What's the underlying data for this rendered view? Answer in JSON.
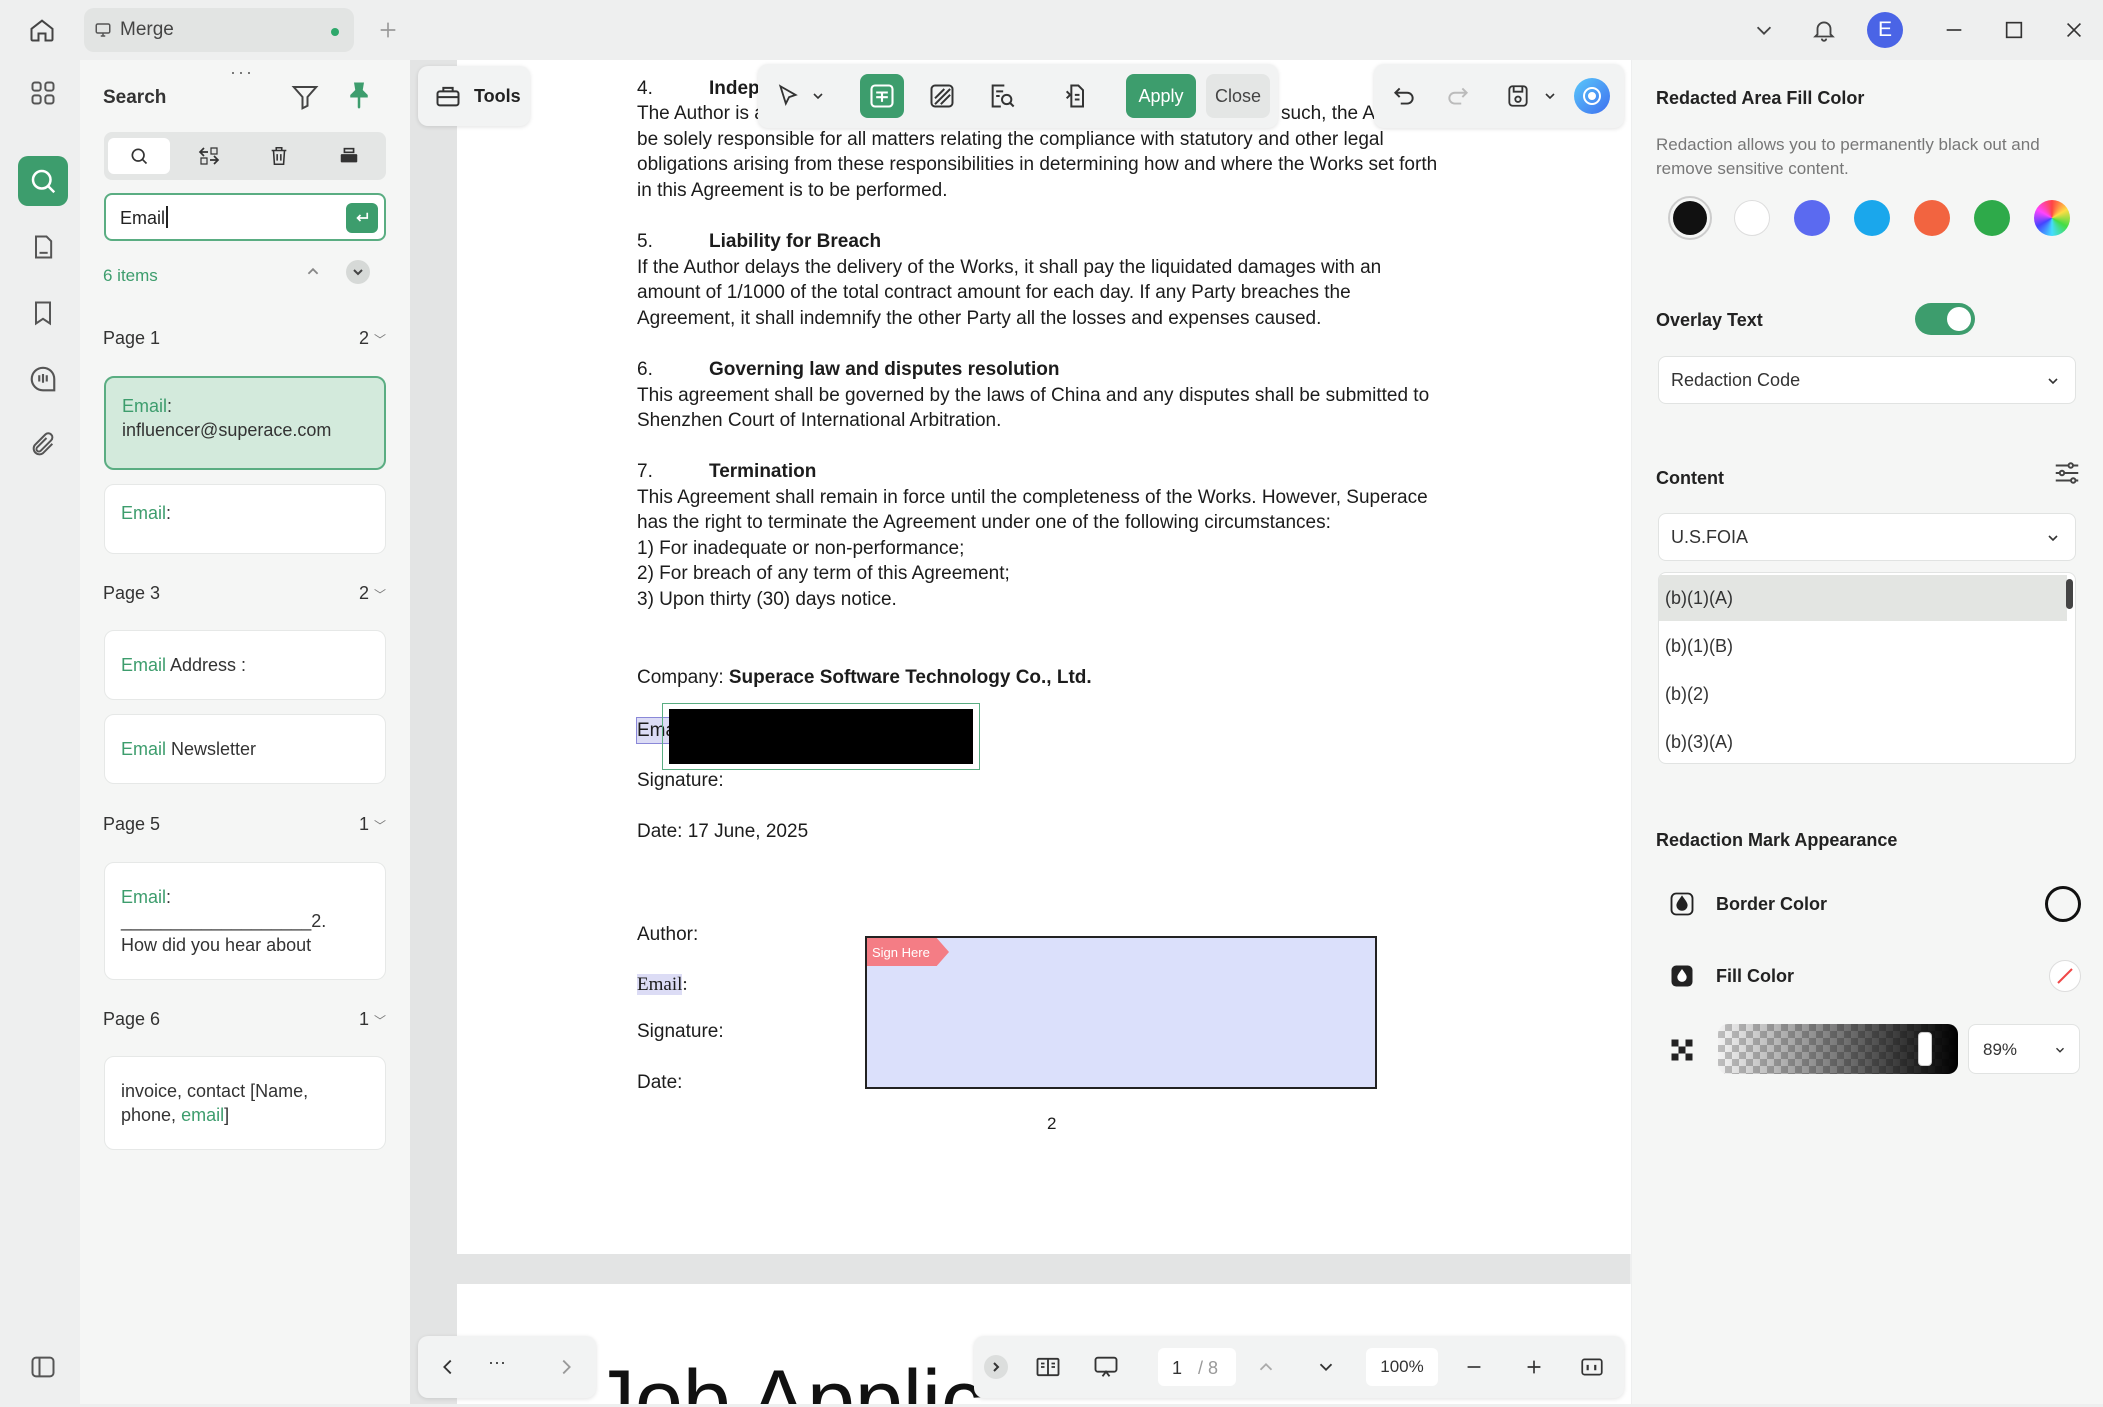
{
  "titlebar": {
    "tab_label": "Merge",
    "avatar_letter": "E",
    "icons": [
      "home-icon",
      "monitor-icon",
      "plus-icon",
      "chevron-down-icon",
      "bell-icon",
      "minimize-icon",
      "maximize-icon",
      "close-icon"
    ]
  },
  "rail": {
    "icons": [
      "grid-icon",
      "search-icon",
      "page-icon",
      "bookmark-icon",
      "comment-icon",
      "attachment-icon",
      "sidebar-toggle-icon"
    ]
  },
  "search_panel": {
    "title": "Search",
    "query": "Email",
    "items_count": "6 items",
    "groups": [
      {
        "page": "Page 1",
        "count": "2"
      },
      {
        "page": "Page 3",
        "count": "2"
      },
      {
        "page": "Page 5",
        "count": "1"
      },
      {
        "page": "Page 6",
        "count": "1"
      }
    ],
    "results": [
      {
        "match": "Email",
        "rest": ":",
        "line2": "influencer@superace.com"
      },
      {
        "match": "Email",
        "rest": ":"
      },
      {
        "match": "Email",
        "rest": " Address :"
      },
      {
        "match": "Email",
        "rest": " Newsletter"
      },
      {
        "match": "Email",
        "rest": ":",
        "line2": "___________________2.",
        "line3": "How did you hear about"
      },
      {
        "pre": "invoice, contact [Name,",
        "pre2": "phone, ",
        "match": "email",
        "post": "]"
      }
    ]
  },
  "tools_button": "Tools",
  "redact_toolbar": {
    "apply": "Apply",
    "close": "Close"
  },
  "document": {
    "s4_num": "4.",
    "s4_title": "Indep",
    "s4_l1a": "The Author is a",
    "s4_l1b": "such, the A",
    "s4_l2": "be solely responsible for all matters relating the compliance with statutory and other legal",
    "s4_l3": "obligations arising from these responsibilities in determining how and where the Works set forth",
    "s4_l4": "in this Agreement is to be performed.",
    "s5_num": "5.",
    "s5_title": "Liability for Breach",
    "s5_l1": "If the Author delays the delivery of the Works, it shall pay the liquidated damages with an",
    "s5_l2": "amount of 1/1000 of the total contract amount for each day. If any Party breaches the",
    "s5_l3": "Agreement, it shall indemnify the other Party all the losses and expenses caused.",
    "s6_num": "6.",
    "s6_title": "Governing law and disputes resolution",
    "s6_l1": "This agreement shall be governed by the laws of China and any disputes shall be submitted to",
    "s6_l2": "Shenzhen Court of International Arbitration.",
    "s7_num": "7.",
    "s7_title": "Termination",
    "s7_l1": "This Agreement shall remain in force until the completeness of the Works. However, Superace",
    "s7_l2": "has the right to terminate the Agreement under one of the following circumstances:",
    "s7_l3": "1) For inadequate or non-performance;",
    "s7_l4": "2) For breach of any term of this Agreement;",
    "s7_l5": "3)  Upon thirty (30) days notice.",
    "company_label": "Company: ",
    "company_name": "Superace Software Technology Co., Ltd.",
    "email_partial": "Ema",
    "signature1": "Signature:",
    "date1": "Date: 17 June, 2025",
    "author": "Author:",
    "email2": "Email",
    "email2_colon": ":",
    "signature2": "Signature:",
    "date2": "Date:",
    "sign_here": "Sign Here",
    "page_number": "2",
    "next_page_title": "Job Applic"
  },
  "bottom_bar": {
    "more": "···",
    "current_page": "1",
    "total_pages": "/ 8",
    "zoom": "100%"
  },
  "right_panel": {
    "fill_color_title": "Redacted Area Fill Color",
    "fill_color_desc": "Redaction allows you to permanently black out and remove sensitive content.",
    "swatches": [
      "#111111",
      "#ffffff",
      "#5b6af0",
      "#1aa7ec",
      "#f26440",
      "#2eaa4a",
      "rainbow"
    ],
    "overlay_text_label": "Overlay Text",
    "overlay_text_on": true,
    "overlay_dropdown": "Redaction Code",
    "content_label": "Content",
    "content_dropdown": "U.S.FOIA",
    "codes": [
      "(b)(1)(A)",
      "(b)(1)(B)",
      "(b)(2)",
      "(b)(3)(A)"
    ],
    "appearance_title": "Redaction Mark Appearance",
    "border_color_label": "Border Color",
    "fill_color_label": "Fill Color",
    "opacity": "89%"
  }
}
